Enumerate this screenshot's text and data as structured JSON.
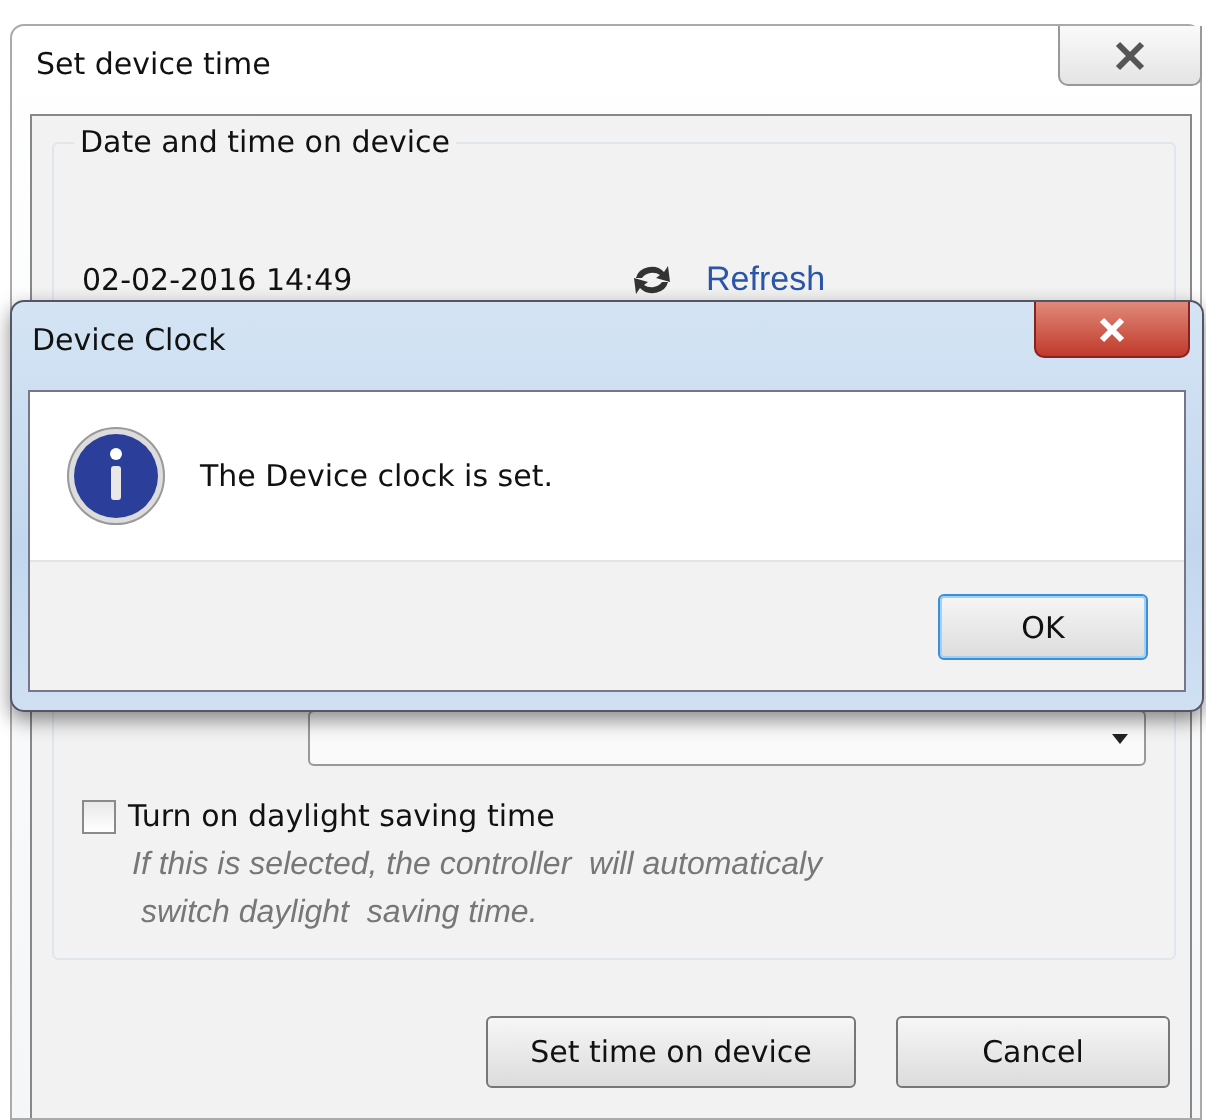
{
  "window": {
    "title": "Set device time"
  },
  "group": {
    "title": "Date and time on device",
    "device_time": "02-02-2016 14:49",
    "refresh": "Refresh",
    "dst": {
      "label": "Turn on daylight saving time",
      "checked": false
    },
    "hint": "If this is selected, the controller  will automaticaly\n switch daylight  saving time."
  },
  "buttons": [
    {
      "label": "Set time on device",
      "default": false
    },
    {
      "label": "Cancel",
      "default": false
    }
  ],
  "dialog": {
    "title": "Device Clock",
    "message": "The Device clock is set.",
    "button": {
      "label": "OK",
      "default": true
    }
  }
}
